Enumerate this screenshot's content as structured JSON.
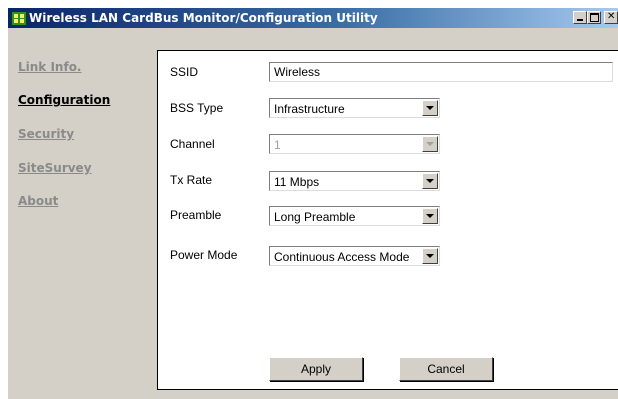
{
  "window": {
    "title": "Wireless LAN CardBus Monitor/Configuration Utility"
  },
  "nav": {
    "items": [
      {
        "label": "Link Info.",
        "active": false
      },
      {
        "label": "Configuration",
        "active": true
      },
      {
        "label": "Security",
        "active": false
      },
      {
        "label": "SiteSurvey",
        "active": false
      },
      {
        "label": "About",
        "active": false
      }
    ]
  },
  "config": {
    "ssid": {
      "label": "SSID",
      "value": "Wireless"
    },
    "bss_type": {
      "label": "BSS Type",
      "value": "Infrastructure"
    },
    "channel": {
      "label": "Channel",
      "value": "1",
      "disabled": true
    },
    "tx_rate": {
      "label": "Tx Rate",
      "value": "11 Mbps"
    },
    "preamble": {
      "label": "Preamble",
      "value": "Long Preamble"
    },
    "power_mode": {
      "label": "Power Mode",
      "value": "Continuous Access Mode"
    }
  },
  "buttons": {
    "apply": "Apply",
    "cancel": "Cancel"
  }
}
